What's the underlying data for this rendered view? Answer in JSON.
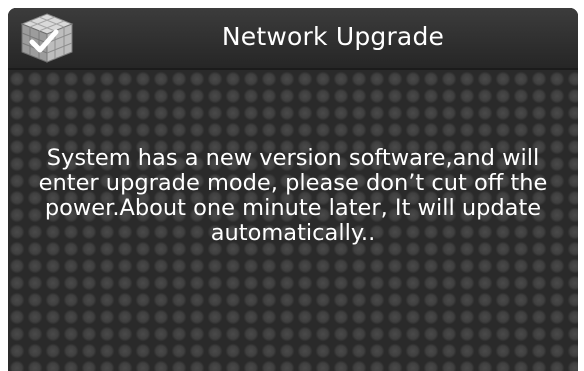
{
  "dialog": {
    "title": "Network Upgrade",
    "icon": "checkmark-cube-icon",
    "message": "System has a new version software,and will enter upgrade mode, please don’t cut off the power.About one minute later, It will update automatically.."
  },
  "colors": {
    "title_bar": "#333333",
    "body_background": "#2a2a2a",
    "pattern_dot": "#444444",
    "text": "#ffffff"
  }
}
